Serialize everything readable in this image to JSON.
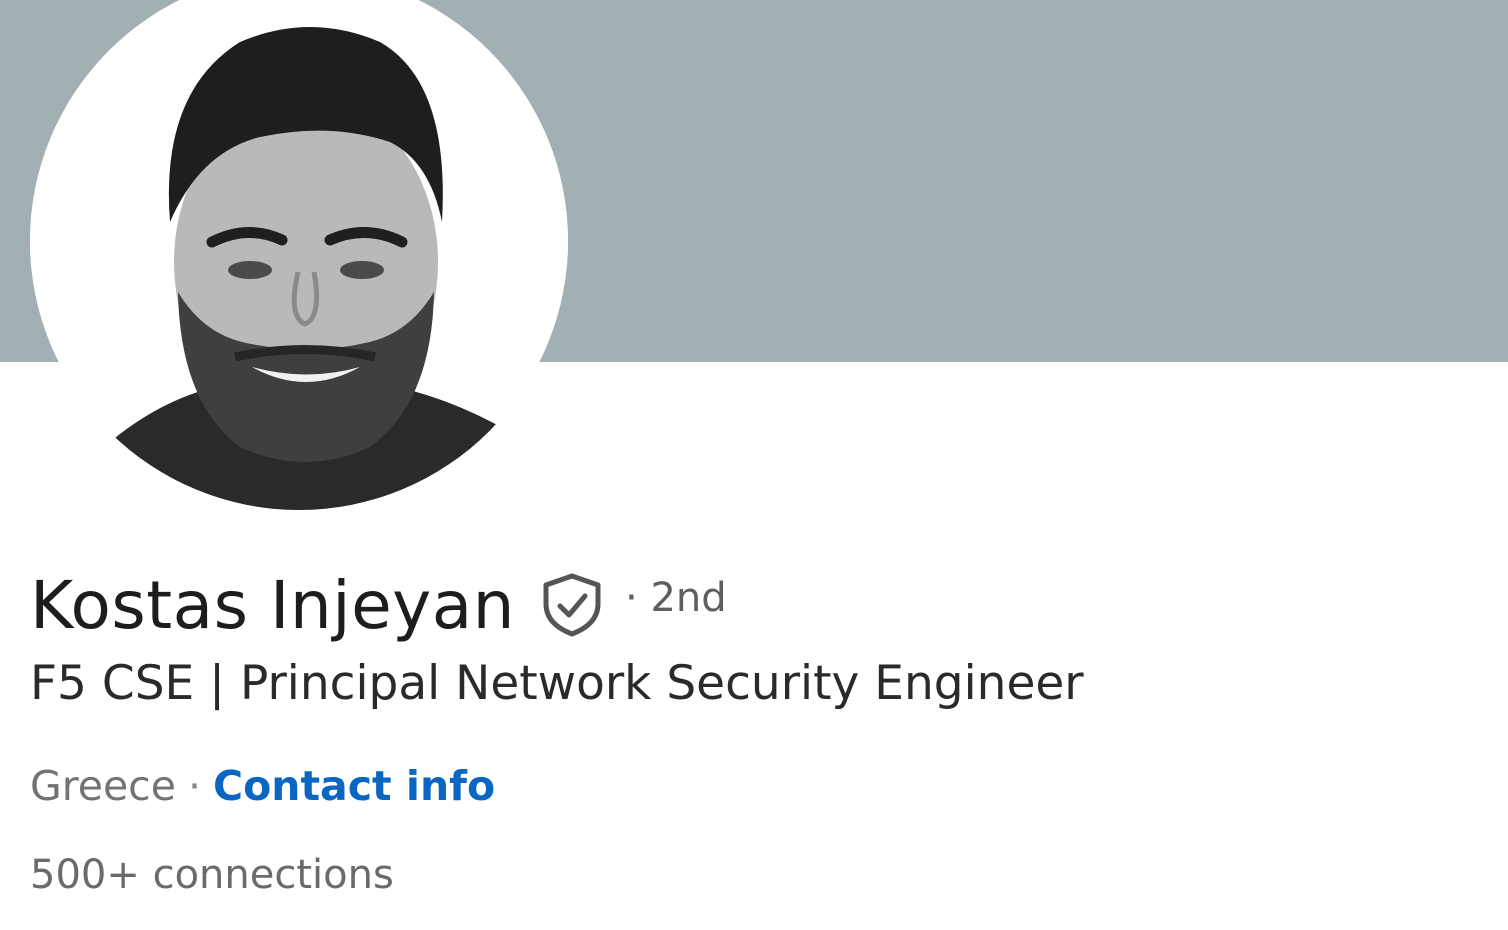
{
  "profile": {
    "name": "Kostas Injeyan",
    "degree": "· 2nd",
    "headline": "F5 CSE | Principal Network Security Engineer",
    "location": "Greece",
    "separator": "·",
    "contact_link": "Contact info",
    "connections": "500+ connections",
    "verified_icon": "shield-check-icon"
  },
  "colors": {
    "banner": "#a2b0b3",
    "link": "#0a66c2"
  }
}
